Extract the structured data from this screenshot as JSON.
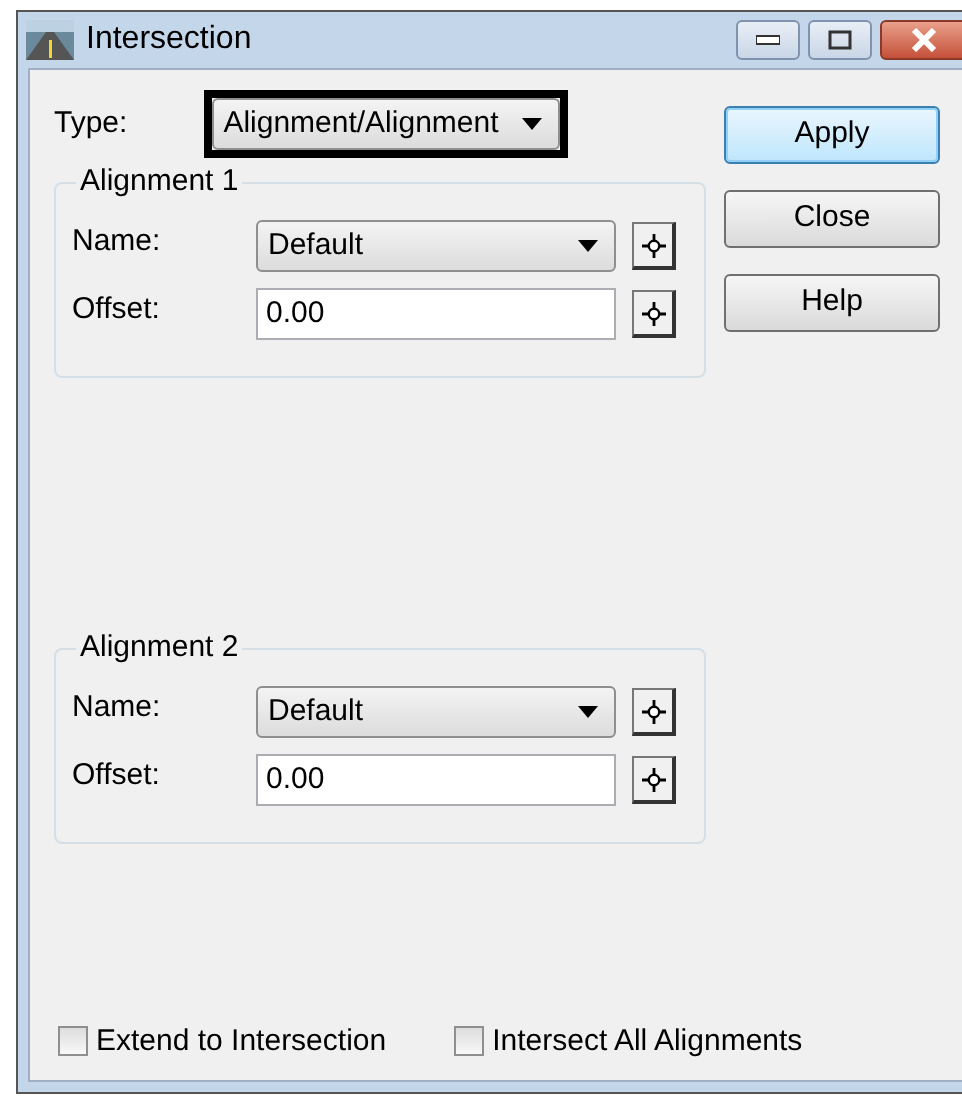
{
  "window": {
    "title": "Intersection"
  },
  "type_field": {
    "label": "Type:",
    "value": "Alignment/Alignment",
    "highlighted": true
  },
  "buttons": [
    {
      "label": "Apply",
      "default": true
    },
    {
      "label": "Close",
      "default": false
    },
    {
      "label": "Help",
      "default": false
    }
  ],
  "groups": [
    {
      "title": "Alignment 1",
      "name_label": "Name:",
      "name_value": "Default",
      "offset_label": "Offset:",
      "offset_value": "0.00"
    },
    {
      "title": "Alignment 2",
      "name_label": "Name:",
      "name_value": "Default",
      "offset_label": "Offset:",
      "offset_value": "0.00"
    }
  ],
  "checkboxes": [
    {
      "label": "Extend to Intersection",
      "checked": false
    },
    {
      "label": "Intersect All Alignments",
      "checked": false
    }
  ]
}
